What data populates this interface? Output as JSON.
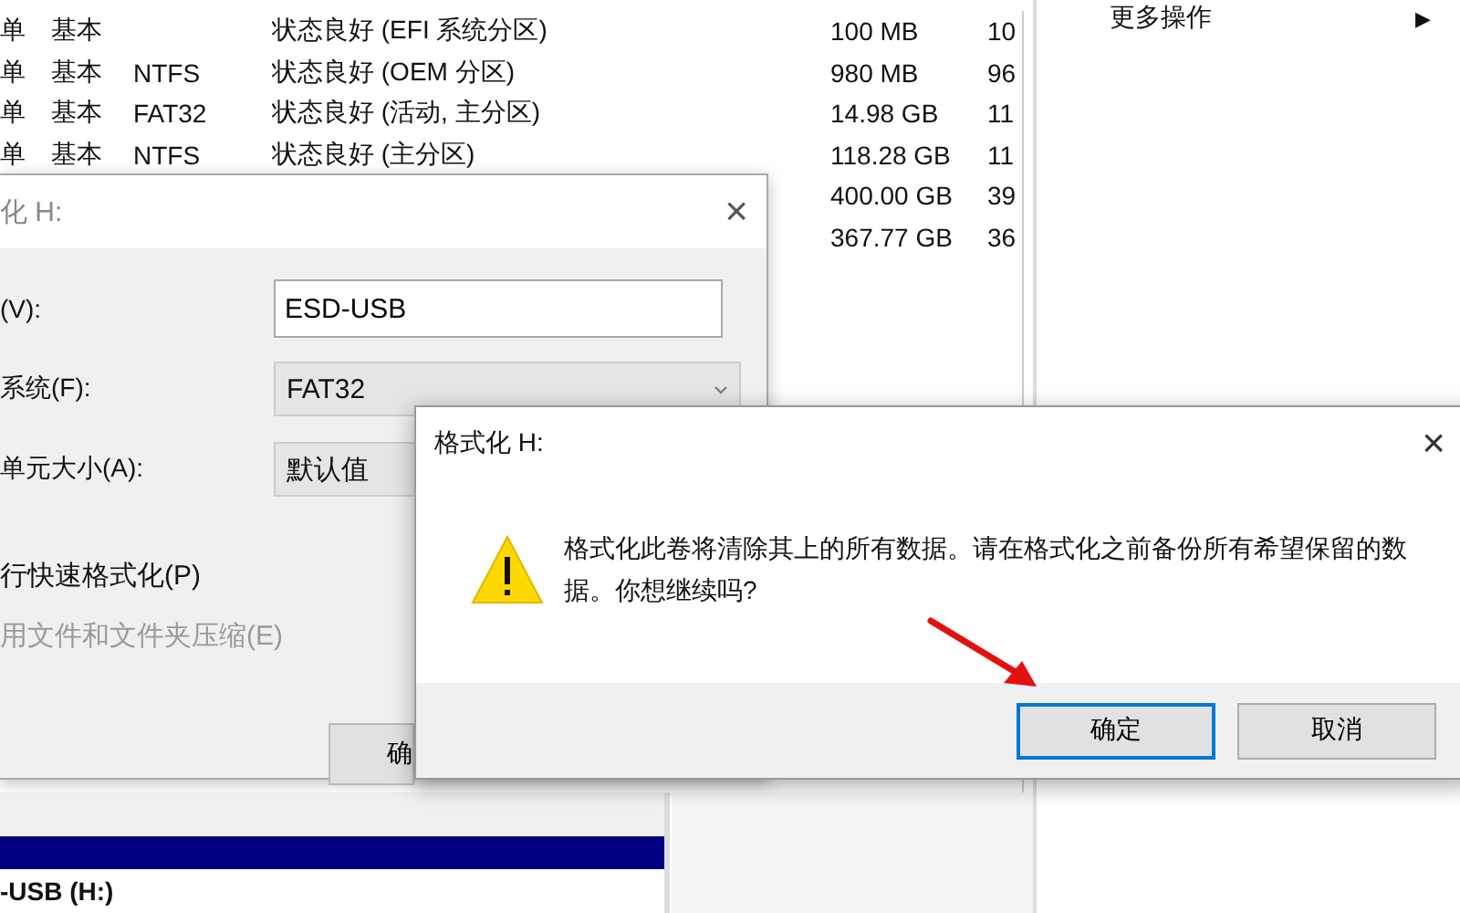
{
  "volume_table": {
    "rows": [
      {
        "layout": "单",
        "type": "基本",
        "status": "状态良好 (EFI 系统分区)",
        "capacity": "100 MB",
        "free": "10"
      },
      {
        "layout": "单",
        "type": "基本",
        "fs": "NTFS",
        "status": "状态良好 (OEM 分区)",
        "capacity": "980 MB",
        "free": "96"
      },
      {
        "layout": "单",
        "type": "基本",
        "fs": "FAT32",
        "status": "状态良好 (活动, 主分区)",
        "capacity": "14.98 GB",
        "free": "11"
      },
      {
        "layout": "单",
        "type": "基本",
        "fs": "NTFS",
        "status": "状态良好 (主分区)",
        "capacity": "118.28 GB",
        "free": "11"
      },
      {
        "capacity": "400.00 GB",
        "free": "39"
      },
      {
        "capacity": "367.77 GB",
        "free": "36"
      }
    ]
  },
  "actions_pane": {
    "items": [
      {
        "label": "更多操作",
        "arrow": "▶"
      }
    ]
  },
  "format_dialog": {
    "title": "化 H:",
    "close": "×",
    "fields": [
      {
        "kind": "input",
        "label": "(V):",
        "value": "ESD-USB"
      },
      {
        "kind": "select",
        "label": "系统(F):",
        "value": "FAT32"
      },
      {
        "kind": "select",
        "label": "单元大小(A):",
        "value": "默认值"
      }
    ],
    "options": [
      {
        "label": "行快速格式化(P)",
        "disabled": false
      },
      {
        "label": "用文件和文件夹压缩(E)",
        "disabled": true
      }
    ],
    "button": "确"
  },
  "disk_map": {
    "volume": "-USB  (H:)"
  },
  "confirm_dialog": {
    "title": "格式化 H:",
    "close": "×",
    "message": "格式化此卷将清除其上的所有数据。请在格式化之前备份所有希望保留的数据。你想继续吗?",
    "buttons": [
      {
        "label": "确定",
        "default": true
      },
      {
        "label": "取消",
        "default": false
      }
    ]
  }
}
